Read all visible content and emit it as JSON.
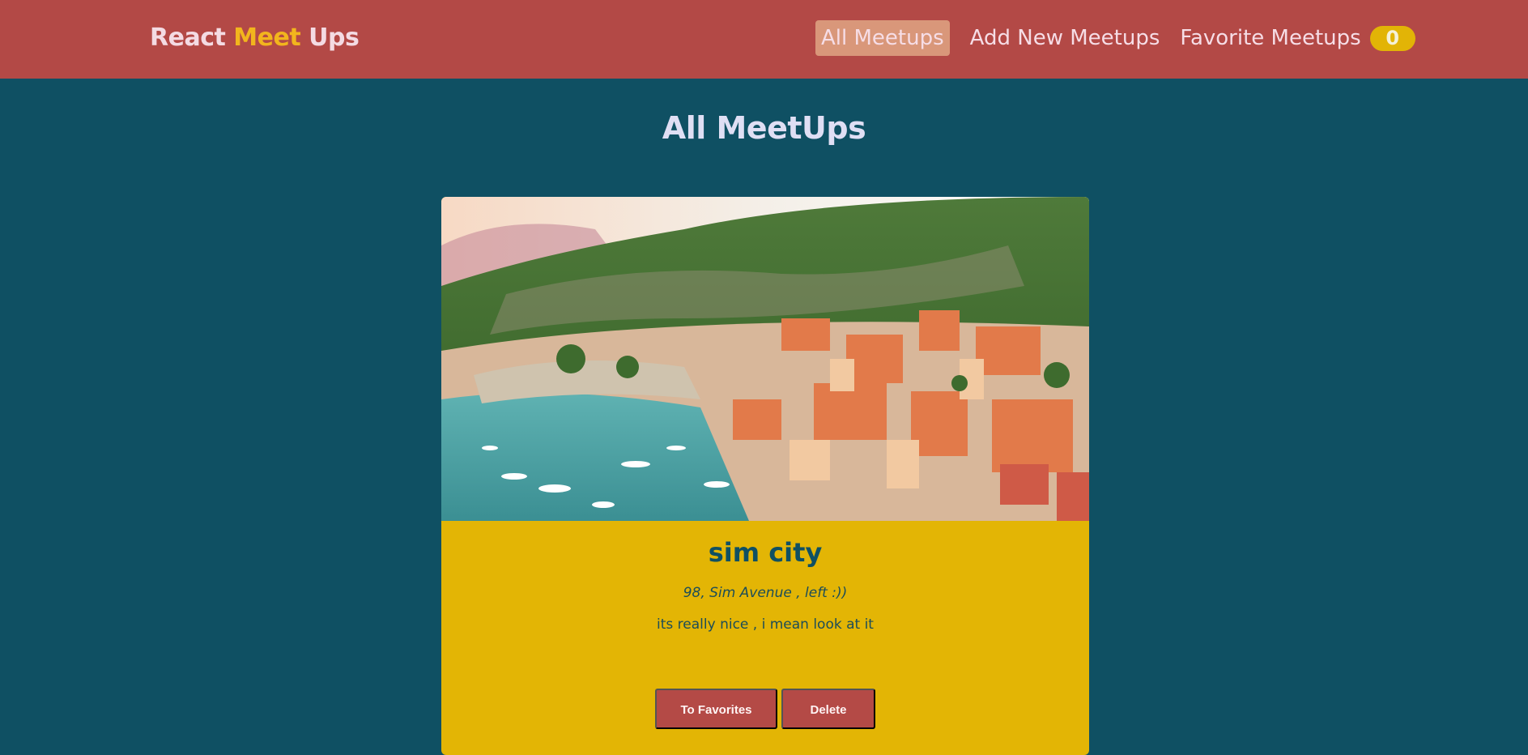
{
  "header": {
    "logo": {
      "part1": "React",
      "part2": "Meet",
      "part3": "Ups"
    },
    "nav": {
      "all": "All Meetups",
      "add": "Add New Meetups",
      "favorites": "Favorite Meetups",
      "favorites_count": "0"
    }
  },
  "main": {
    "title": "All MeetUps",
    "meetups": [
      {
        "title": "sim city",
        "address": "98, Sim Avenue , left :))",
        "description": "its really nice , i mean look at it",
        "favorite_label": "To Favorites",
        "delete_label": "Delete"
      }
    ]
  },
  "colors": {
    "header_bg": "#b34946",
    "page_bg": "#0f5063",
    "card_bg": "#e3b505",
    "accent": "#f2b51d",
    "button_bg": "#b44a46"
  }
}
